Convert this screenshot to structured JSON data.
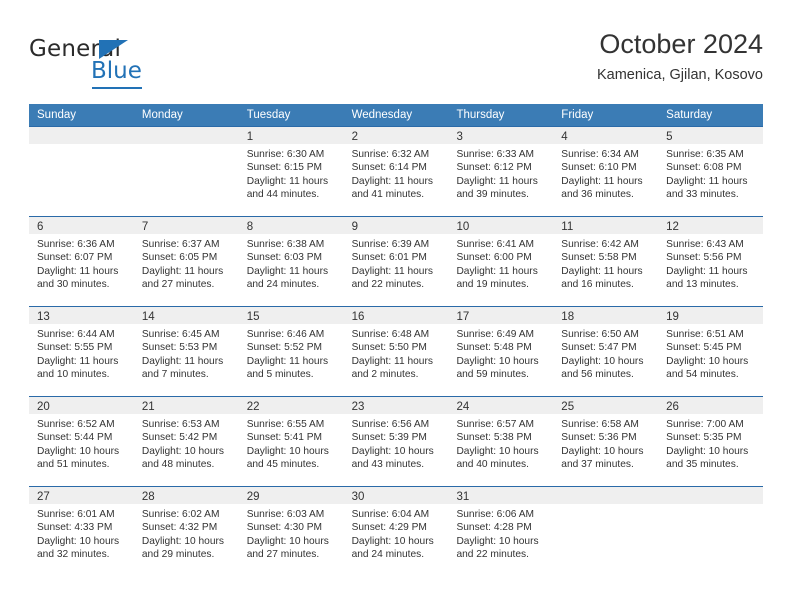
{
  "brand": {
    "name_part1": "General",
    "name_part2": "Blue"
  },
  "header": {
    "title": "October 2024",
    "subtitle": "Kamenica, Gjilan, Kosovo"
  },
  "weekdays": [
    "Sunday",
    "Monday",
    "Tuesday",
    "Wednesday",
    "Thursday",
    "Friday",
    "Saturday"
  ],
  "colors": {
    "header_band": "#3b7cb5",
    "cell_top_border": "#2a6aa8",
    "day_number_band": "#efefef",
    "brand_blue": "#2272b6",
    "text": "#333333"
  },
  "weeks": [
    [
      {
        "empty": true
      },
      {
        "empty": true
      },
      {
        "day": "1",
        "sunrise": "Sunrise: 6:30 AM",
        "sunset": "Sunset: 6:15 PM",
        "daylight": "Daylight: 11 hours and 44 minutes."
      },
      {
        "day": "2",
        "sunrise": "Sunrise: 6:32 AM",
        "sunset": "Sunset: 6:14 PM",
        "daylight": "Daylight: 11 hours and 41 minutes."
      },
      {
        "day": "3",
        "sunrise": "Sunrise: 6:33 AM",
        "sunset": "Sunset: 6:12 PM",
        "daylight": "Daylight: 11 hours and 39 minutes."
      },
      {
        "day": "4",
        "sunrise": "Sunrise: 6:34 AM",
        "sunset": "Sunset: 6:10 PM",
        "daylight": "Daylight: 11 hours and 36 minutes."
      },
      {
        "day": "5",
        "sunrise": "Sunrise: 6:35 AM",
        "sunset": "Sunset: 6:08 PM",
        "daylight": "Daylight: 11 hours and 33 minutes."
      }
    ],
    [
      {
        "day": "6",
        "sunrise": "Sunrise: 6:36 AM",
        "sunset": "Sunset: 6:07 PM",
        "daylight": "Daylight: 11 hours and 30 minutes."
      },
      {
        "day": "7",
        "sunrise": "Sunrise: 6:37 AM",
        "sunset": "Sunset: 6:05 PM",
        "daylight": "Daylight: 11 hours and 27 minutes."
      },
      {
        "day": "8",
        "sunrise": "Sunrise: 6:38 AM",
        "sunset": "Sunset: 6:03 PM",
        "daylight": "Daylight: 11 hours and 24 minutes."
      },
      {
        "day": "9",
        "sunrise": "Sunrise: 6:39 AM",
        "sunset": "Sunset: 6:01 PM",
        "daylight": "Daylight: 11 hours and 22 minutes."
      },
      {
        "day": "10",
        "sunrise": "Sunrise: 6:41 AM",
        "sunset": "Sunset: 6:00 PM",
        "daylight": "Daylight: 11 hours and 19 minutes."
      },
      {
        "day": "11",
        "sunrise": "Sunrise: 6:42 AM",
        "sunset": "Sunset: 5:58 PM",
        "daylight": "Daylight: 11 hours and 16 minutes."
      },
      {
        "day": "12",
        "sunrise": "Sunrise: 6:43 AM",
        "sunset": "Sunset: 5:56 PM",
        "daylight": "Daylight: 11 hours and 13 minutes."
      }
    ],
    [
      {
        "day": "13",
        "sunrise": "Sunrise: 6:44 AM",
        "sunset": "Sunset: 5:55 PM",
        "daylight": "Daylight: 11 hours and 10 minutes."
      },
      {
        "day": "14",
        "sunrise": "Sunrise: 6:45 AM",
        "sunset": "Sunset: 5:53 PM",
        "daylight": "Daylight: 11 hours and 7 minutes."
      },
      {
        "day": "15",
        "sunrise": "Sunrise: 6:46 AM",
        "sunset": "Sunset: 5:52 PM",
        "daylight": "Daylight: 11 hours and 5 minutes."
      },
      {
        "day": "16",
        "sunrise": "Sunrise: 6:48 AM",
        "sunset": "Sunset: 5:50 PM",
        "daylight": "Daylight: 11 hours and 2 minutes."
      },
      {
        "day": "17",
        "sunrise": "Sunrise: 6:49 AM",
        "sunset": "Sunset: 5:48 PM",
        "daylight": "Daylight: 10 hours and 59 minutes."
      },
      {
        "day": "18",
        "sunrise": "Sunrise: 6:50 AM",
        "sunset": "Sunset: 5:47 PM",
        "daylight": "Daylight: 10 hours and 56 minutes."
      },
      {
        "day": "19",
        "sunrise": "Sunrise: 6:51 AM",
        "sunset": "Sunset: 5:45 PM",
        "daylight": "Daylight: 10 hours and 54 minutes."
      }
    ],
    [
      {
        "day": "20",
        "sunrise": "Sunrise: 6:52 AM",
        "sunset": "Sunset: 5:44 PM",
        "daylight": "Daylight: 10 hours and 51 minutes."
      },
      {
        "day": "21",
        "sunrise": "Sunrise: 6:53 AM",
        "sunset": "Sunset: 5:42 PM",
        "daylight": "Daylight: 10 hours and 48 minutes."
      },
      {
        "day": "22",
        "sunrise": "Sunrise: 6:55 AM",
        "sunset": "Sunset: 5:41 PM",
        "daylight": "Daylight: 10 hours and 45 minutes."
      },
      {
        "day": "23",
        "sunrise": "Sunrise: 6:56 AM",
        "sunset": "Sunset: 5:39 PM",
        "daylight": "Daylight: 10 hours and 43 minutes."
      },
      {
        "day": "24",
        "sunrise": "Sunrise: 6:57 AM",
        "sunset": "Sunset: 5:38 PM",
        "daylight": "Daylight: 10 hours and 40 minutes."
      },
      {
        "day": "25",
        "sunrise": "Sunrise: 6:58 AM",
        "sunset": "Sunset: 5:36 PM",
        "daylight": "Daylight: 10 hours and 37 minutes."
      },
      {
        "day": "26",
        "sunrise": "Sunrise: 7:00 AM",
        "sunset": "Sunset: 5:35 PM",
        "daylight": "Daylight: 10 hours and 35 minutes."
      }
    ],
    [
      {
        "day": "27",
        "sunrise": "Sunrise: 6:01 AM",
        "sunset": "Sunset: 4:33 PM",
        "daylight": "Daylight: 10 hours and 32 minutes."
      },
      {
        "day": "28",
        "sunrise": "Sunrise: 6:02 AM",
        "sunset": "Sunset: 4:32 PM",
        "daylight": "Daylight: 10 hours and 29 minutes."
      },
      {
        "day": "29",
        "sunrise": "Sunrise: 6:03 AM",
        "sunset": "Sunset: 4:30 PM",
        "daylight": "Daylight: 10 hours and 27 minutes."
      },
      {
        "day": "30",
        "sunrise": "Sunrise: 6:04 AM",
        "sunset": "Sunset: 4:29 PM",
        "daylight": "Daylight: 10 hours and 24 minutes."
      },
      {
        "day": "31",
        "sunrise": "Sunrise: 6:06 AM",
        "sunset": "Sunset: 4:28 PM",
        "daylight": "Daylight: 10 hours and 22 minutes."
      },
      {
        "empty": true
      },
      {
        "empty": true
      }
    ]
  ]
}
